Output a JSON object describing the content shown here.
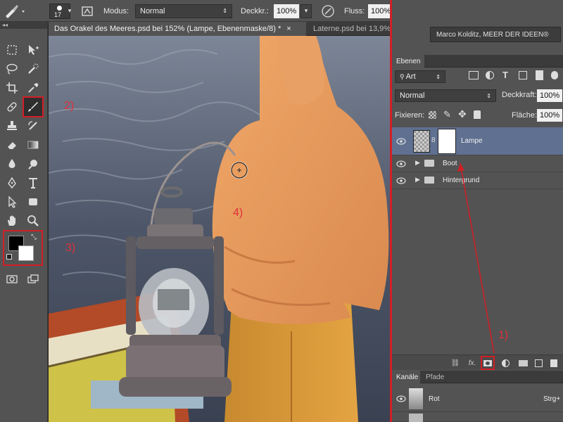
{
  "options_bar": {
    "brush_size": "17",
    "modus_label": "Modus:",
    "modus_value": "Normal",
    "deckkraft_label": "Deckkr.:",
    "deckkraft_value": "100%",
    "fluss_label": "Fluss:",
    "fluss_value": "100%"
  },
  "document_tabs": [
    {
      "label": "Das Orakel des Meeres.psd bei 152% (Lampe, Ebenenmaske/8) *",
      "close": "×",
      "active": true
    },
    {
      "label": "Laterne.psd bei 13,9%",
      "active": false
    }
  ],
  "workspace_label": "Marco Kolditz, MEER DER IDEEN®",
  "layers_panel": {
    "tab_label": "Ebenen",
    "filter_value": "Art",
    "blend_mode": "Normal",
    "opacity_label": "Deckkraft:",
    "opacity_value": "100%",
    "lock_label": "Fixieren:",
    "fill_label": "Fläche:",
    "fill_value": "100%",
    "layers": [
      {
        "name": "Lampe",
        "selected": true
      },
      {
        "name": "Boot",
        "selected": false
      },
      {
        "name": "Hintergrund",
        "selected": false
      }
    ],
    "fx_label": "fx."
  },
  "channels_panel": {
    "tabs": [
      "Kanäle",
      "Pfade"
    ],
    "channels": [
      {
        "name": "Rot",
        "shortcut": "Strg+"
      }
    ]
  },
  "annotations": [
    "1)",
    "2)",
    "3)",
    "4)"
  ],
  "colors": {
    "accent_red": "#d21f26",
    "jacket": "#e3955a",
    "foreground_color": "#000000",
    "background_color": "#ffffff"
  }
}
